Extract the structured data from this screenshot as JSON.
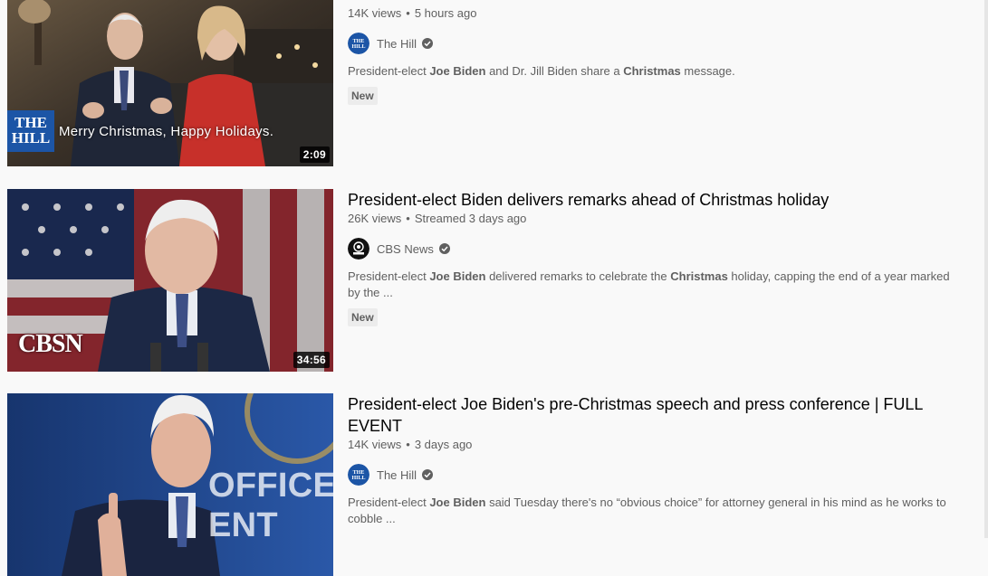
{
  "videos": [
    {
      "title": "",
      "views": "14K views",
      "age": "5 hours ago",
      "channel": "The Hill",
      "description_parts": [
        "President-elect ",
        "Joe Biden",
        " and Dr. Jill Biden share a ",
        "Christmas",
        " message."
      ],
      "badge": "New",
      "duration": "2:09",
      "overlay_text": "Merry Christmas, Happy Holidays.",
      "logo_line1": "THE",
      "logo_line2": "HILL"
    },
    {
      "title": "President-elect Biden delivers remarks ahead of Christmas holiday",
      "views": "26K views",
      "age": "Streamed 3 days ago",
      "channel": "CBS News",
      "description_parts": [
        "President-elect ",
        "Joe Biden",
        " delivered remarks to celebrate the ",
        "Christmas",
        " holiday, capping the end of a year marked by the ..."
      ],
      "badge": "New",
      "duration": "34:56",
      "overlay_text": "CBSN"
    },
    {
      "title": "President-elect Joe Biden's pre-Christmas speech and press conference | FULL EVENT",
      "views": "14K views",
      "age": "3 days ago",
      "channel": "The Hill",
      "description_parts": [
        "President-elect ",
        "Joe Biden",
        " said Tuesday there's no “obvious choice” for attorney general in his mind as he works to cobble ..."
      ],
      "overlay_text": "OFFICE\nENT"
    }
  ],
  "colors": {
    "text_primary": "#030303",
    "text_secondary": "#606060",
    "background": "#f9f9f9"
  }
}
